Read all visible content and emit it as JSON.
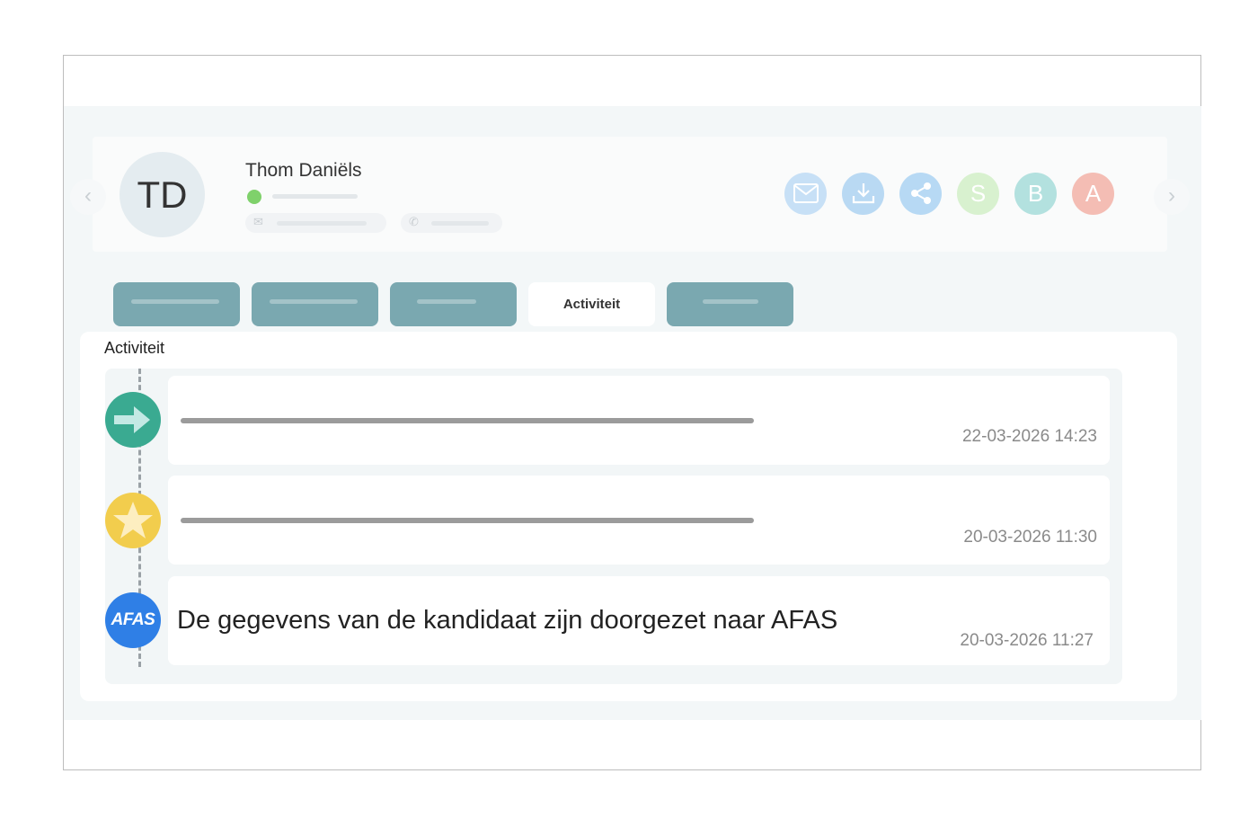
{
  "colors": {
    "tab": "#7aa8b0",
    "status": "#7fd16b",
    "mail": "#c7e0f6",
    "download": "#b9d9f3",
    "share": "#b7d9f4",
    "s": "#d8f1cf",
    "b": "#b3e1df",
    "a": "#f4bdb4",
    "arrow": "#3aaa91",
    "star": "#f2cd4d",
    "afas": "#2f7fe6"
  },
  "header": {
    "avatar_initials": "TD",
    "name": "Thom Daniëls",
    "icons": {
      "prev": "chevron-left-icon",
      "next": "chevron-right-icon",
      "email": "mail-icon",
      "phone": "phone-icon"
    },
    "actions": [
      {
        "icon": "mail-icon"
      },
      {
        "icon": "download-icon"
      },
      {
        "icon": "share-icon"
      },
      {
        "label": "S"
      },
      {
        "label": "B"
      },
      {
        "label": "A"
      }
    ]
  },
  "tabs": [
    {
      "label": ""
    },
    {
      "label": ""
    },
    {
      "label": ""
    },
    {
      "label": "Activiteit",
      "active": true
    },
    {
      "label": ""
    }
  ],
  "activity": {
    "title": "Activiteit",
    "entries": [
      {
        "icon": "arrow-right-icon",
        "text": "",
        "time": "22-03-2026 14:23"
      },
      {
        "icon": "star-icon",
        "text": "",
        "time": "20-03-2026 11:30"
      },
      {
        "icon": "afas-logo",
        "logo_text": "AFAS",
        "text": "De gegevens van de kandidaat zijn doorgezet naar AFAS",
        "time": "20-03-2026 11:27"
      }
    ]
  }
}
